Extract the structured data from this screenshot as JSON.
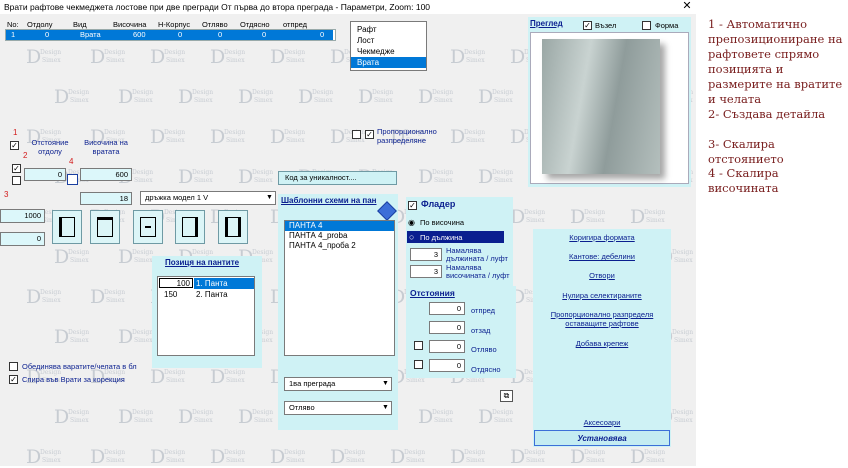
{
  "window": {
    "title": "Врати рафтове чекмеджета лостове при две прегради  От първа до втора  преграда - Параметри, Zoom:  100",
    "close_label": "✕"
  },
  "watermark": {
    "big": "D",
    "word1": "Design",
    "word2": "Simex"
  },
  "table": {
    "headers": [
      "No:",
      "Отдолу",
      "Вид",
      "Височина",
      "Н-Корпус",
      "Отляво",
      "Отдясно",
      "отпред"
    ],
    "rows": [
      [
        "1",
        "0",
        "Врата",
        "600",
        "0",
        "0",
        "0",
        "0"
      ]
    ]
  },
  "type_list": {
    "items": [
      "Рафт",
      "Лост",
      "Чекмедже",
      "Врата"
    ],
    "selected": "Врата"
  },
  "preview": {
    "title": "Преглед",
    "cb1_label": "Възел",
    "cb1_checked": true,
    "cb2_label": "Форма",
    "cb2_checked": false
  },
  "proportional": {
    "label": "Пропорционално разпределяне"
  },
  "left": {
    "label_otstoyanie": "Отстояние отдолу",
    "label_visochina": "Височина на вратата",
    "field_otdolu": "0",
    "field_visochina": "600",
    "field_18": "18",
    "handle_model": "дръжка модел 1 V",
    "field_1000": "1000",
    "field_0": "0"
  },
  "markers": {
    "m1": "1",
    "m2": "2",
    "m3": "3",
    "m4": "4"
  },
  "hinge_pos": {
    "title": "Позиця на пантите",
    "rows": [
      {
        "value": "100",
        "label": "1. Панта"
      },
      {
        "value": "150",
        "label": "2. Панта"
      }
    ]
  },
  "checkboxes": {
    "merge_label": "Обединява варатите/челата в бл",
    "stop_label": "Спира във Врати за корекция"
  },
  "unique_btn": "Код за уникалност....",
  "templates": {
    "title": "Шаблонни схеми на пан",
    "items": [
      "ПАНТА 4",
      "ПАНТА 4_proba",
      "ПАНТА 4_проба 2"
    ],
    "selected": "ПАНТА 4"
  },
  "flader": {
    "title": "Фладер",
    "opt1": "По височина",
    "opt2": "По дължина",
    "reduce_len_value": "3",
    "reduce_len_label": "Намалява дължината / луфт",
    "reduce_hgt_value": "3",
    "reduce_hgt_label": "Намалява височината / луфт"
  },
  "distances": {
    "title": "Отстояния",
    "rows": [
      {
        "value": "0",
        "label": "отпред"
      },
      {
        "value": "0",
        "label": "отзад"
      },
      {
        "value": "0",
        "label": "Отляво"
      },
      {
        "value": "0",
        "label": "Отдясно"
      }
    ]
  },
  "dropdowns": {
    "partition": "1ва преграда",
    "side": "Отляво"
  },
  "links": {
    "correct_shape": "Коригира формата",
    "edges": "Кантове: дебелини",
    "openings": "Отвори",
    "reset_selected": "Нулира селектираните",
    "proportional": "Пропорционално разпределя оставащите рафтове",
    "add_fixing": "Добава крепеж",
    "accessories": "Аксесоари",
    "install": "Установява"
  },
  "annotations": [
    "1 - Автоматично препозициониране на рафтовете спрямо позицията и размерите на вратите и челата",
    "2- Създава детайла",
    "3- Скалира отстоянието",
    "4 - Скалира височината"
  ]
}
